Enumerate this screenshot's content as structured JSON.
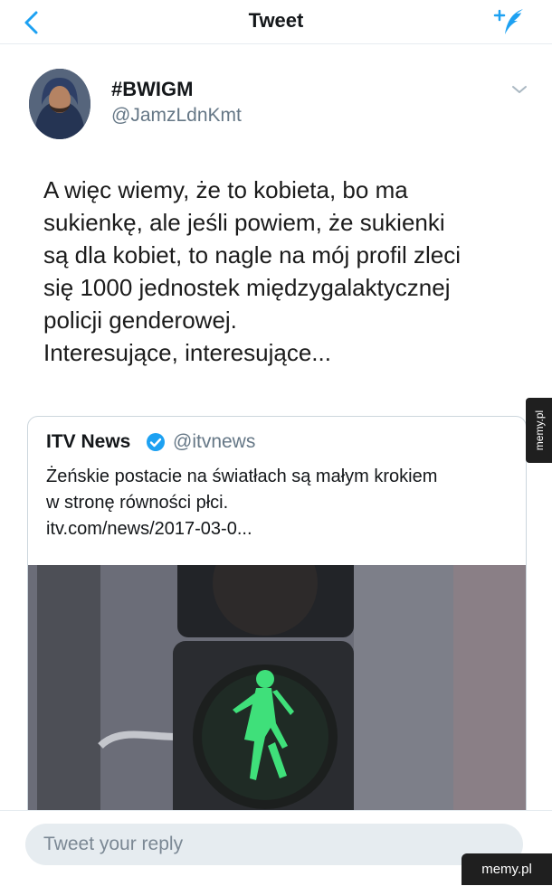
{
  "header": {
    "title": "Tweet",
    "back_icon": "chevron-left-icon",
    "compose_icon": "compose-tweet-icon"
  },
  "colors": {
    "accent": "#1da1f2",
    "secondary_text": "#657786",
    "divider": "#e6ecf0"
  },
  "tweet": {
    "display_name": "#BWIGM",
    "handle": "@JamzLdnKmt",
    "text_lines": [
      "A więc wiemy, że to kobieta, bo ma",
      "sukienkę, ale jeśli powiem, że sukienki",
      "są dla kobiet, to nagle na mój profil zleci",
      "się 1000 jednostek międzygalaktycznej",
      "policji genderowej.",
      "Interesujące, interesujące..."
    ]
  },
  "quoted_tweet": {
    "name": "ITV News",
    "handle": "@itvnews",
    "text_lines": [
      "Żeńskie postacie na światłach są małym krokiem",
      "w stronę równości płci.",
      "itv.com/news/2017-03-0..."
    ]
  },
  "reply": {
    "placeholder": "Tweet your reply"
  },
  "watermarks": {
    "side": "memy.pl",
    "corner": "memy.pl"
  }
}
